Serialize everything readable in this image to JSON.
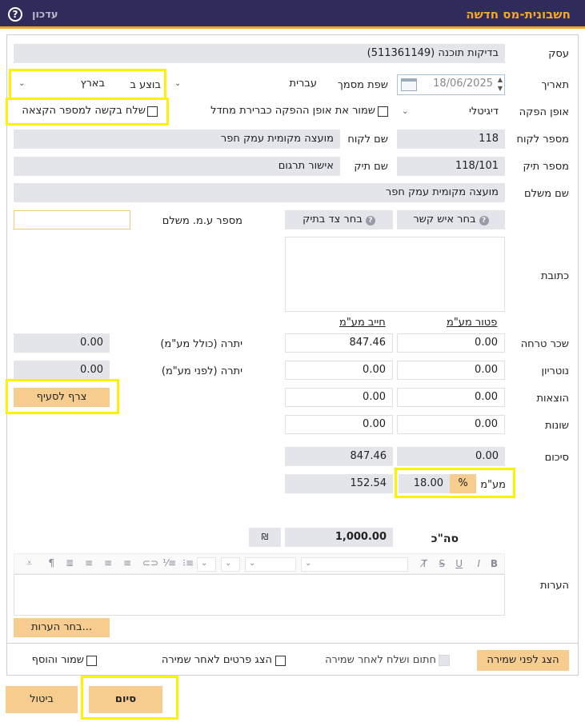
{
  "header": {
    "title": "חשבונית-מס חדשה",
    "update": "עדכון",
    "help": "?"
  },
  "labels": {
    "business": "עסק",
    "date": "תאריך",
    "doc_lang": "שפת מסמך",
    "performed_in": "בוצע ב",
    "issue_method": "אופן הפקה",
    "save_issue_default": "שמור את אופן ההפקה כברירת מחדל",
    "send_request_allocation": "שלח בקשה למספר הקצאה",
    "customer_number": "מספר לקוח",
    "customer_name": "שם לקוח",
    "file_number": "מספר תיק",
    "file_name": "שם תיק",
    "payer_name": "שם משלם",
    "payer_vat_no": "מספר ע.מ. משלם",
    "address": "כתובת",
    "vat_exempt": "פטור מע\"מ",
    "vat_liable": "חייב מע\"מ",
    "fee": "שכר טרחה",
    "notary": "נוטריון",
    "expenses": "הוצאות",
    "misc": "שונות",
    "summary": "סיכום",
    "vat": "מע\"מ",
    "total": "סה\"כ",
    "notes": "הערות",
    "balance_incl_vat": "יתרה (כולל מע\"מ)",
    "balance_before_vat": "יתרה (לפני מע\"מ)"
  },
  "values": {
    "business": "בדיקות תוכנה (511361149)",
    "date": "18/06/2025",
    "doc_lang": "עברית",
    "performed_in": "בארץ",
    "issue_method": "דיגיטלי",
    "customer_number": "118",
    "customer_name": "מועצה מקומית עמק חפר",
    "file_number": "118/101",
    "file_name": "אישור תרגום",
    "payer_name": "מועצה מקומית עמק חפר",
    "payer_vat_no": "",
    "fee_exempt": "0.00",
    "fee_liable": "847.46",
    "notary_exempt": "0.00",
    "notary_liable": "0.00",
    "expenses_exempt": "0.00",
    "expenses_liable": "0.00",
    "misc_exempt": "0.00",
    "misc_liable": "0.00",
    "summary_exempt": "0.00",
    "summary_liable": "847.46",
    "vat_rate": "18.00",
    "vat_percent_sign": "%",
    "vat_amount": "152.54",
    "total": "1,000.00",
    "currency": "₪",
    "balance_incl_vat": "0.00",
    "balance_before_vat": "0.00"
  },
  "buttons": {
    "choose_contact": "בחר איש קשר",
    "choose_file_side": "בחר צד בתיק",
    "attach_section": "צרף לסעיף",
    "choose_notes": "בחר הערות...",
    "preview_before_save": "הצג לפני שמירה",
    "sign_send_after_save": "חתום ושלח לאחר שמירה",
    "show_details_after_save": "הצג פרטים לאחר שמירה",
    "save_and_add": "שמור והוסף",
    "finish": "סיום",
    "cancel": "ביטול"
  },
  "colors": {
    "header_bg": "#2f2c5c",
    "accent": "#f5a623",
    "highlight": "#fff200",
    "readonly_bg": "#e3e5ea",
    "orange_btn": "#f6cd8f"
  }
}
